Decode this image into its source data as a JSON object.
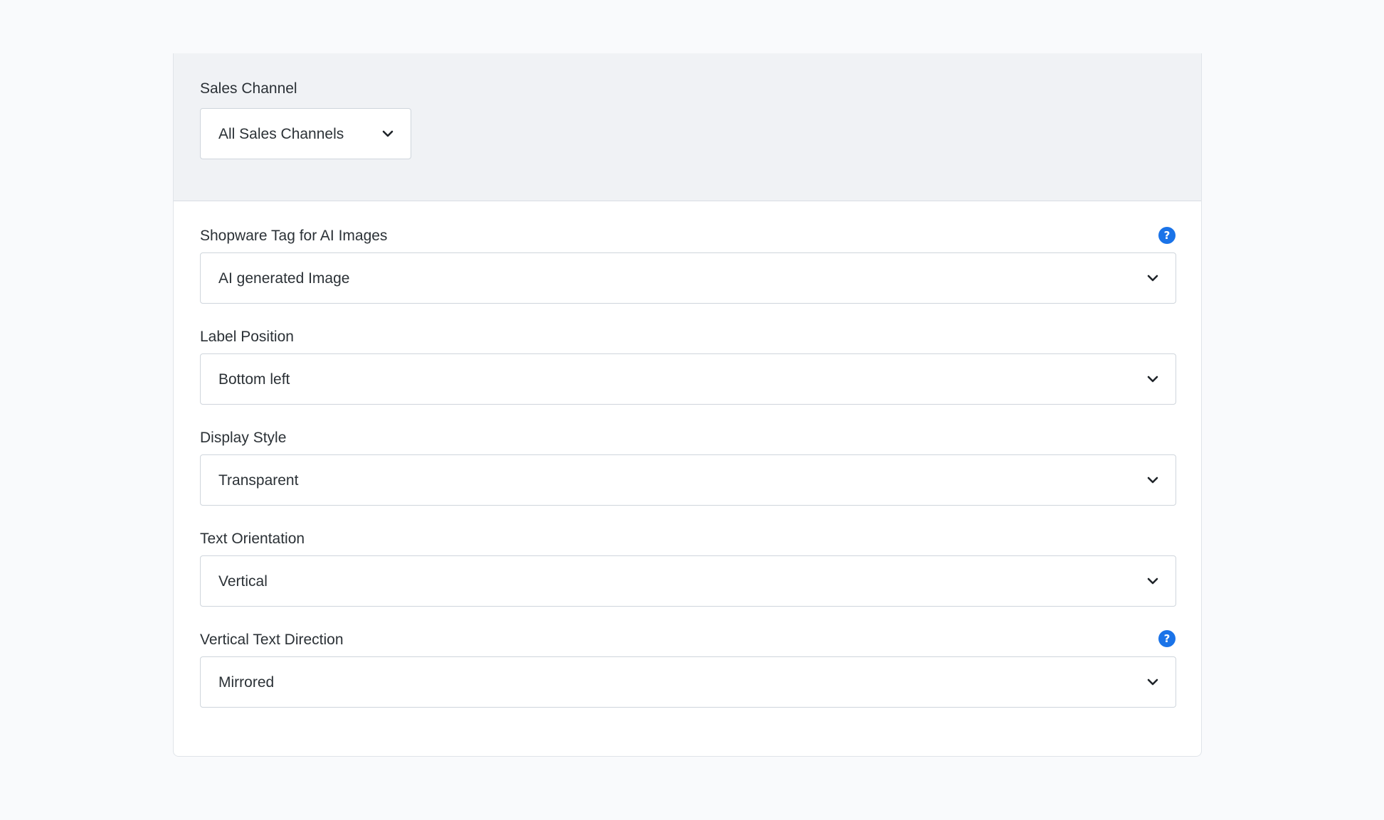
{
  "sales_channel": {
    "label": "Sales Channel",
    "value": "All Sales Channels"
  },
  "fields": [
    {
      "label": "Shopware Tag for AI Images",
      "value": "AI generated Image",
      "help": "?"
    },
    {
      "label": "Label Position",
      "value": "Bottom left"
    },
    {
      "label": "Display Style",
      "value": "Transparent"
    },
    {
      "label": "Text Orientation",
      "value": "Vertical"
    },
    {
      "label": "Vertical Text Direction",
      "value": "Mirrored",
      "help": "?"
    }
  ],
  "icons": {
    "dropdown": "chevron-down-icon",
    "help": "help-icon"
  },
  "colors": {
    "accent": "#1a73e8",
    "page_background": "#f9fafc",
    "header_background": "#f0f2f5"
  }
}
